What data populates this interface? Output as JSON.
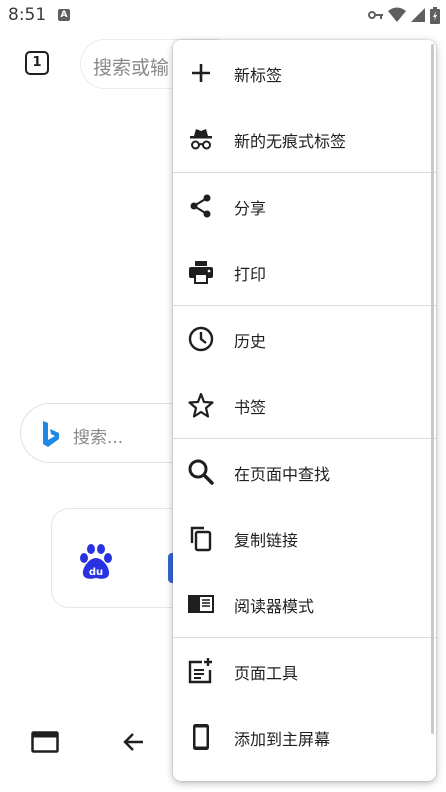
{
  "status_bar": {
    "time": "8:51",
    "notification_letter": "A"
  },
  "toolbar": {
    "tab_count": "1",
    "url_placeholder": "搜索或输"
  },
  "page": {
    "search_placeholder": "搜索...",
    "shortcuts": [
      {
        "name": "baidu-logo",
        "logo_text": "du"
      }
    ]
  },
  "menu": {
    "items": [
      {
        "label": "新标签",
        "icon": "plus-icon"
      },
      {
        "label": "新的无痕式标签",
        "icon": "incognito-icon"
      },
      {
        "label": "分享",
        "icon": "share-icon"
      },
      {
        "label": "打印",
        "icon": "print-icon"
      },
      {
        "label": "历史",
        "icon": "history-icon"
      },
      {
        "label": "书签",
        "icon": "star-icon"
      },
      {
        "label": "在页面中查找",
        "icon": "search-icon"
      },
      {
        "label": "复制链接",
        "icon": "copy-icon"
      },
      {
        "label": "阅读器模式",
        "icon": "reader-mode-icon"
      },
      {
        "label": "页面工具",
        "icon": "page-tools-icon"
      },
      {
        "label": "添加到主屏幕",
        "icon": "phone-icon"
      }
    ]
  },
  "colors": {
    "accent_blue": "#3367d6",
    "baidu_blue": "#2932e1",
    "bing_blue": "#1e88e5"
  }
}
